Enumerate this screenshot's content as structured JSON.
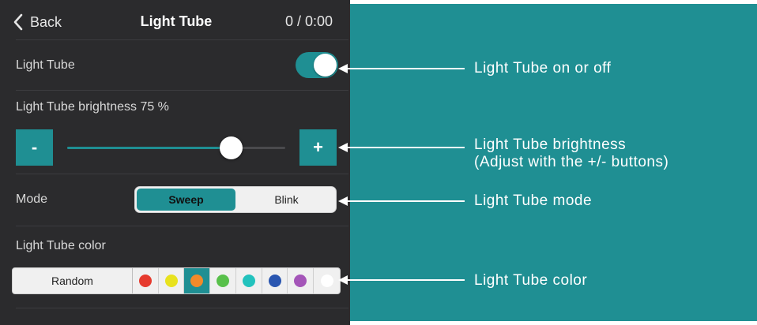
{
  "header": {
    "back_label": "Back",
    "title": "Light Tube",
    "time": "0 / 0:00"
  },
  "toggle_row": {
    "label": "Light Tube",
    "on": true
  },
  "brightness": {
    "label": "Light Tube brightness 75 %",
    "value_percent": 75,
    "minus_label": "-",
    "plus_label": "+"
  },
  "mode": {
    "label": "Mode",
    "options": [
      "Sweep",
      "Blink"
    ],
    "selected": "Sweep"
  },
  "color": {
    "label": "Light Tube color",
    "random_label": "Random",
    "swatches": [
      "#e63a2e",
      "#e8e21e",
      "#f28a2a",
      "#58c04a",
      "#22c2bd",
      "#2a56b0",
      "#a455b8",
      "#ffffff"
    ],
    "selected_index": 2
  },
  "annotations": [
    {
      "line1": "Light Tube on or off",
      "line2": ""
    },
    {
      "line1": "Light Tube brightness",
      "line2": "(Adjust with the +/- buttons)"
    },
    {
      "line1": "Light Tube mode",
      "line2": ""
    },
    {
      "line1": "Light Tube color",
      "line2": ""
    }
  ],
  "colors": {
    "accent": "#1f8f93",
    "panel": "#2b2b2d",
    "annotation_bg": "#1f8f93"
  }
}
